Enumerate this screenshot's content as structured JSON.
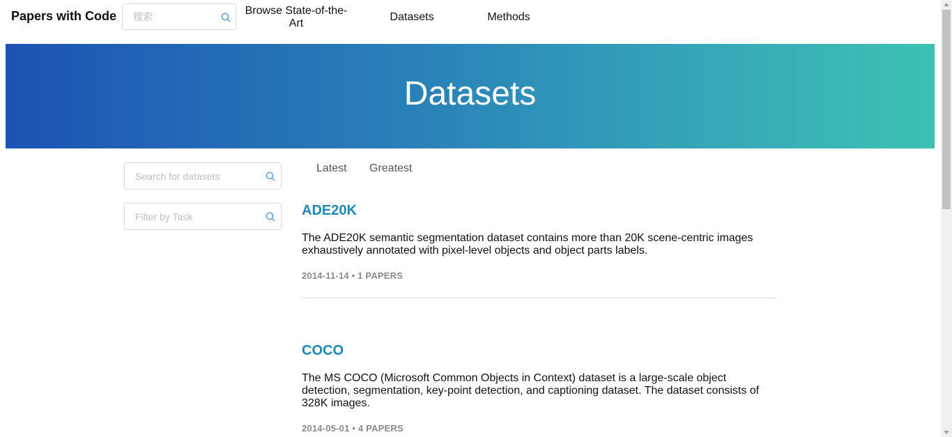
{
  "brand": "Papers with Code",
  "nav": {
    "search_placeholder": "搜索",
    "links": [
      "Browse State-of-the-Art",
      "Datasets",
      "Methods"
    ]
  },
  "hero": {
    "title": "Datasets"
  },
  "filters": {
    "dataset_search_placeholder": "Search for datasets",
    "task_filter_placeholder": "Filter by Task"
  },
  "sort_tabs": [
    "Latest",
    "Greatest"
  ],
  "datasets": [
    {
      "name": "ADE20K",
      "description": "The ADE20K semantic segmentation dataset contains more than 20K scene-centric images exhaustively annotated with pixel-level objects and object parts labels.",
      "date": "2014-11-14",
      "papers": "1 PAPERS"
    },
    {
      "name": "COCO",
      "description": "The MS COCO (Microsoft Common Objects in Context) dataset is a large-scale object detection, segmentation, key-point detection, and captioning dataset. The dataset consists of 328K images.",
      "date": "2014-05-01",
      "papers": "4 PAPERS"
    }
  ],
  "icons": {
    "search": "search-icon",
    "search_icon_color": "#4a90e2"
  },
  "colors": {
    "accent_link": "#1e88b5",
    "hero_gradient_start": "#1c53b4",
    "hero_gradient_end": "#3dc1b2"
  }
}
